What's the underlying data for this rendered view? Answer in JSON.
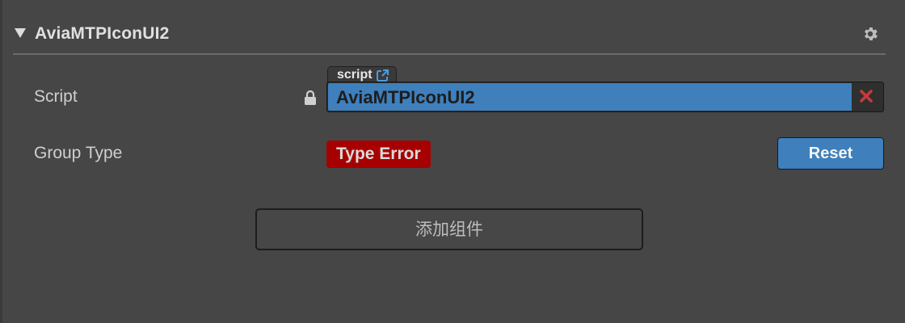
{
  "component": {
    "title": "AviaMTPIconUI2",
    "collapse_icon": "triangle-down-icon",
    "settings_icon": "gear-icon"
  },
  "properties": {
    "script": {
      "label": "Script",
      "lock_icon": "lock-icon",
      "tag_label": "script",
      "tag_icon": "external-link-icon",
      "value": "AviaMTPIconUI2",
      "clear_icon": "close-icon"
    },
    "group_type": {
      "label": "Group Type",
      "error_text": "Type Error",
      "reset_label": "Reset"
    }
  },
  "actions": {
    "add_component_label": "添加组件"
  },
  "colors": {
    "background": "#464646",
    "accent_blue": "#3e7fbc",
    "error_red": "#a70000",
    "clear_red": "#c63b3b"
  }
}
